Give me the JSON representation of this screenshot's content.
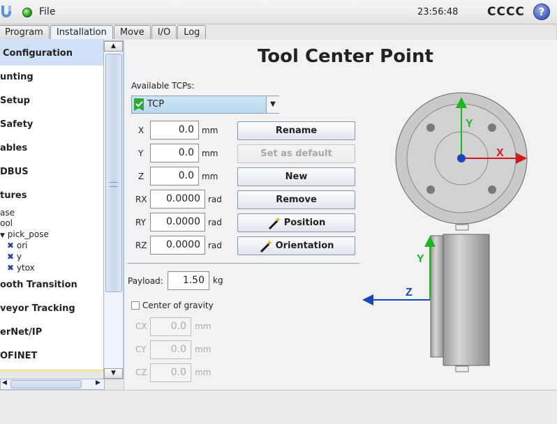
{
  "header": {
    "file_menu": "File",
    "time": "23:56:48",
    "robot_name": "CCCC",
    "help_glyph": "?"
  },
  "tabs": [
    {
      "label": "Program"
    },
    {
      "label": "Installation",
      "active": true
    },
    {
      "label": "Move"
    },
    {
      "label": "I/O"
    },
    {
      "label": "Log"
    }
  ],
  "tree": {
    "items": [
      "Configuration",
      "unting",
      "Setup",
      "Safety",
      "ables",
      "DBUS",
      "tures",
      "ooth Transition",
      "veyor Tracking",
      "erNet/IP",
      "OFINET"
    ],
    "subitems": [
      "ase",
      "ool",
      "pick_pose",
      "ori",
      "y",
      "ytox"
    ]
  },
  "main": {
    "title": "Tool Center Point",
    "available_label": "Available TCPs:",
    "selected_tcp": "TCP",
    "coords": [
      {
        "label": "X",
        "value": "0.0",
        "unit": "mm"
      },
      {
        "label": "Y",
        "value": "0.0",
        "unit": "mm"
      },
      {
        "label": "Z",
        "value": "0.0",
        "unit": "mm"
      },
      {
        "label": "RX",
        "value": "0.0000",
        "unit": "rad"
      },
      {
        "label": "RY",
        "value": "0.0000",
        "unit": "rad"
      },
      {
        "label": "RZ",
        "value": "0.0000",
        "unit": "rad"
      }
    ],
    "buttons": [
      {
        "label": "Rename",
        "enabled": true
      },
      {
        "label": "Set as default",
        "enabled": false
      },
      {
        "label": "New",
        "enabled": true
      },
      {
        "label": "Remove",
        "enabled": true
      },
      {
        "label": "Position",
        "enabled": true,
        "icon": "wand-icon"
      },
      {
        "label": "Orientation",
        "enabled": true,
        "icon": "wand-icon"
      }
    ],
    "payload_label": "Payload:",
    "payload_value": "1.50",
    "payload_unit": "kg",
    "cog_label": "Center of gravity",
    "cog_checked": false,
    "cog": [
      {
        "label": "CX",
        "value": "0.0",
        "unit": "mm"
      },
      {
        "label": "CY",
        "value": "0.0",
        "unit": "mm"
      },
      {
        "label": "CZ",
        "value": "0.0",
        "unit": "mm"
      }
    ]
  },
  "diagram": {
    "front_axes": {
      "x": "X",
      "y": "Y"
    },
    "side_axes": {
      "y": "Y",
      "z": "Z"
    },
    "colors": {
      "x": "#d01a1a",
      "y": "#1fb524",
      "z": "#1848b8"
    }
  }
}
